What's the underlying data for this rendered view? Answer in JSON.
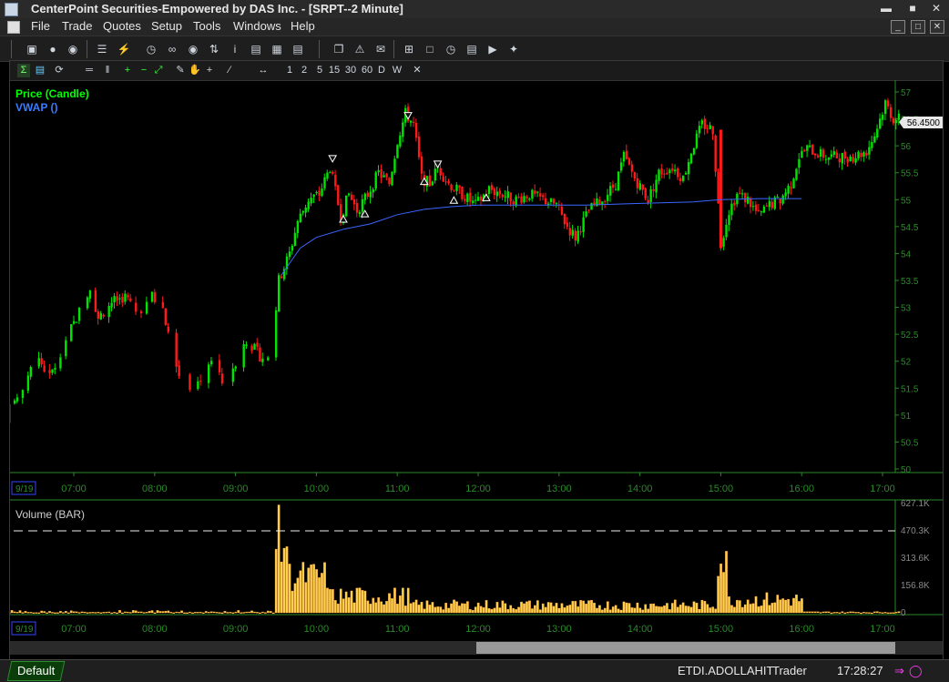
{
  "window": {
    "title": "CenterPoint Securities-Empowered by DAS Inc. - [SRPT--2 Minute]"
  },
  "menu": {
    "items": [
      "File",
      "Trade",
      "Quotes",
      "Setup",
      "Tools",
      "Windows",
      "Help"
    ]
  },
  "chart_toolbar": {
    "intervals": [
      "1",
      "2",
      "5",
      "15",
      "30",
      "60",
      "D",
      "W"
    ]
  },
  "colors": {
    "up": "#00e400",
    "down": "#ff1a1a",
    "vwap": "#3a66ff",
    "volume": "#ffd24d",
    "axis": "#2a8a2a",
    "label_green": "#00ff00"
  },
  "chart_data": [
    {
      "type": "candlestick",
      "legend": [
        "Price (Candle)",
        "VWAP ()"
      ],
      "x_ticks": [
        "07:00",
        "08:00",
        "09:00",
        "10:00",
        "11:00",
        "12:00",
        "13:00",
        "14:00",
        "15:00",
        "16:00",
        "17:00"
      ],
      "date_label": "9/19",
      "y_ticks": [
        "57",
        "56.5",
        "56",
        "55.5",
        "55",
        "54.5",
        "54",
        "53.5",
        "53",
        "52.5",
        "52",
        "51.5",
        "51",
        "50.5",
        "50"
      ],
      "ylim": [
        50,
        57
      ],
      "last_price_label": "56.4500",
      "price_path": [
        [
          "06:00",
          50.2
        ],
        [
          "06:06",
          50.8
        ],
        [
          "06:14",
          51.1
        ],
        [
          "06:24",
          51.5
        ],
        [
          "06:34",
          52.1
        ],
        [
          "06:44",
          51.7
        ],
        [
          "06:54",
          52.3
        ],
        [
          "07:04",
          52.8
        ],
        [
          "07:14",
          53.4
        ],
        [
          "07:20",
          52.8
        ],
        [
          "07:30",
          53.1
        ],
        [
          "07:40",
          53.2
        ],
        [
          "07:50",
          52.9
        ],
        [
          "08:00",
          53.2
        ],
        [
          "08:08",
          53.0
        ],
        [
          "08:14",
          52.2
        ],
        [
          "08:22",
          51.6
        ],
        [
          "08:30",
          51.4
        ],
        [
          "08:36",
          51.7
        ],
        [
          "08:44",
          52.0
        ],
        [
          "08:52",
          51.6
        ],
        [
          "09:00",
          51.9
        ],
        [
          "09:10",
          52.4
        ],
        [
          "09:20",
          52.1
        ],
        [
          "09:28",
          52.0
        ],
        [
          "09:34",
          53.5
        ],
        [
          "09:42",
          54.0
        ],
        [
          "09:48",
          54.6
        ],
        [
          "09:56",
          55.0
        ],
        [
          "10:04",
          55.1
        ],
        [
          "10:12",
          55.6
        ],
        [
          "10:20",
          54.7
        ],
        [
          "10:26",
          55.1
        ],
        [
          "10:32",
          54.8
        ],
        [
          "10:40",
          55.1
        ],
        [
          "10:48",
          55.5
        ],
        [
          "10:56",
          55.3
        ],
        [
          "11:02",
          56.1
        ],
        [
          "11:08",
          56.6
        ],
        [
          "11:14",
          56.4
        ],
        [
          "11:20",
          55.4
        ],
        [
          "11:26",
          55.3
        ],
        [
          "11:32",
          55.6
        ],
        [
          "11:40",
          55.3
        ],
        [
          "11:50",
          55.1
        ],
        [
          "12:00",
          54.9
        ],
        [
          "12:10",
          55.2
        ],
        [
          "12:20",
          55.1
        ],
        [
          "12:30",
          55.0
        ],
        [
          "12:40",
          55.1
        ],
        [
          "12:50",
          55.0
        ],
        [
          "13:00",
          54.9
        ],
        [
          "13:08",
          54.5
        ],
        [
          "13:14",
          54.3
        ],
        [
          "13:24",
          54.8
        ],
        [
          "13:34",
          55.0
        ],
        [
          "13:44",
          55.3
        ],
        [
          "13:50",
          55.8
        ],
        [
          "13:58",
          55.4
        ],
        [
          "14:08",
          55.0
        ],
        [
          "14:16",
          55.5
        ],
        [
          "14:26",
          55.6
        ],
        [
          "14:34",
          55.4
        ],
        [
          "14:40",
          55.9
        ],
        [
          "14:48",
          56.4
        ],
        [
          "14:56",
          56.3
        ],
        [
          "15:02",
          54.2
        ],
        [
          "15:08",
          54.8
        ],
        [
          "15:14",
          55.1
        ],
        [
          "15:22",
          55.0
        ],
        [
          "15:30",
          54.7
        ],
        [
          "15:38",
          54.9
        ],
        [
          "15:46",
          55.0
        ],
        [
          "15:54",
          55.3
        ],
        [
          "16:00",
          55.8
        ],
        [
          "16:06",
          55.95
        ],
        [
          "16:20",
          55.8
        ],
        [
          "16:40",
          55.8
        ],
        [
          "16:50",
          55.9
        ],
        [
          "16:56",
          56.2
        ],
        [
          "17:04",
          56.8
        ],
        [
          "17:10",
          56.5
        ]
      ],
      "vwap_path": [
        [
          "09:34",
          53.6
        ],
        [
          "09:48",
          54.1
        ],
        [
          "10:00",
          54.3
        ],
        [
          "10:20",
          54.45
        ],
        [
          "10:40",
          54.55
        ],
        [
          "11:00",
          54.72
        ],
        [
          "11:20",
          54.82
        ],
        [
          "11:40",
          54.87
        ],
        [
          "12:00",
          54.9
        ],
        [
          "12:40",
          54.9
        ],
        [
          "13:20",
          54.9
        ],
        [
          "14:00",
          54.93
        ],
        [
          "14:40",
          54.96
        ],
        [
          "15:00",
          55.0
        ],
        [
          "15:30",
          55.02
        ],
        [
          "16:00",
          55.02
        ]
      ]
    },
    {
      "type": "bar",
      "legend": [
        "Volume (BAR)"
      ],
      "y_ticks": [
        "627.1K",
        "470.3K",
        "313.6K",
        "156.8K",
        "0"
      ],
      "ylim": [
        0,
        627100
      ],
      "x_ticks": [
        "07:00",
        "08:00",
        "09:00",
        "10:00",
        "11:00",
        "12:00",
        "13:00",
        "14:00",
        "15:00",
        "16:00",
        "17:00"
      ],
      "date_label": "9/19"
    }
  ],
  "status": {
    "tab": "Default",
    "account": "ETDI.ADOLLAHIT",
    "role": "Trader",
    "time": "17:28:27"
  }
}
